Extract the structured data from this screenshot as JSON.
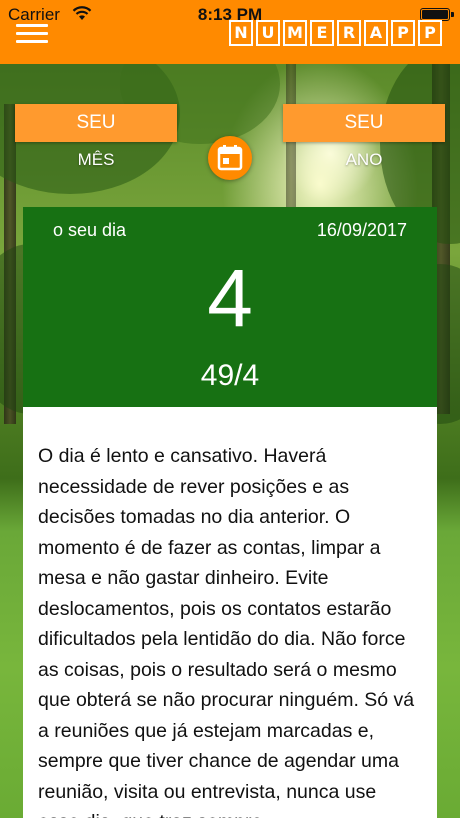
{
  "status_bar": {
    "carrier": "Carrier",
    "time": "8:13 PM"
  },
  "header": {
    "logo_letters": [
      "N",
      "U",
      "M",
      "E",
      "R",
      "A",
      "P",
      "P"
    ],
    "accent_color": "#ff8a00"
  },
  "tabs": {
    "left_button": "SEU",
    "left_label": "MÊS",
    "right_button": "SEU",
    "right_label": "ANO"
  },
  "day_card": {
    "label": "o seu dia",
    "date": "16/09/2017",
    "number": "4",
    "reduction": "49/4",
    "color": "#177113"
  },
  "description": {
    "text": "O dia é lento e cansativo. Haverá necessidade de rever posições e as decisões tomadas no dia anterior. O momento é de fazer as contas, limpar a mesa e não gastar dinheiro. Evite deslocamentos, pois os contatos estarão dificultados pela lentidão do dia. Não force as coisas, pois o resultado será o mesmo que obterá se não procurar ninguém. Só vá a reuniões que já estejam marcadas e, sempre que tiver chance de agendar uma reunião, visita ou entrevista, nunca use esse dia, que traz sempre"
  }
}
